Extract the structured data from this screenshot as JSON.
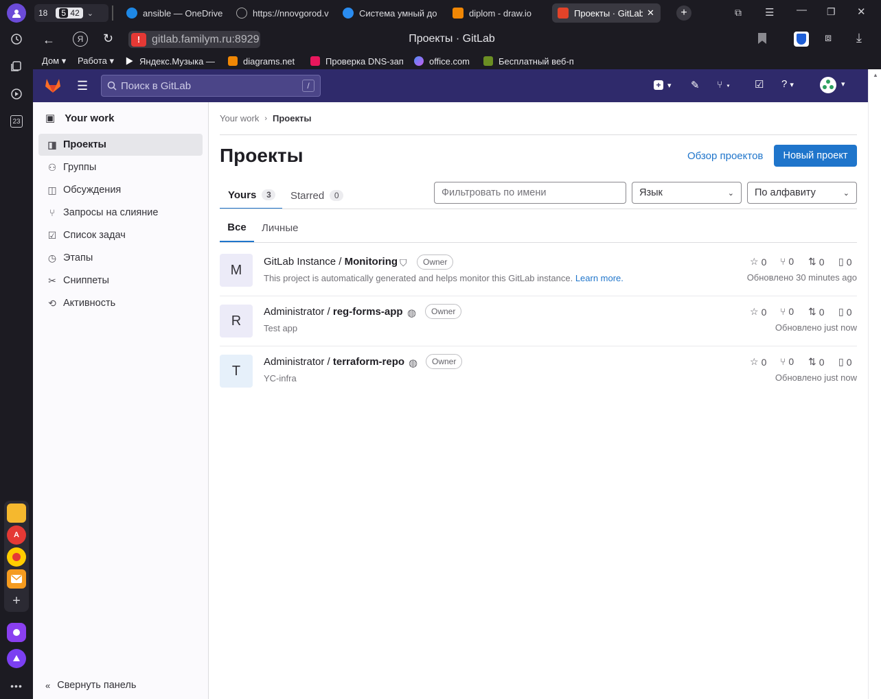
{
  "browser": {
    "tab_counter": "18",
    "tab_badge_a": "5",
    "tab_badge_b": "42",
    "tabs": [
      {
        "label": "ansible — OneDrive",
        "fav_color": "#1e88e5"
      },
      {
        "label": "https://nnovgorod.v",
        "fav_color": "#555"
      },
      {
        "label": "Система умный до",
        "fav_color": "#2a8cf0"
      },
      {
        "label": "diplom - draw.io",
        "fav_color": "#f08705"
      },
      {
        "label": "Проекты · GitLab",
        "fav_color": "#e24329"
      }
    ],
    "url": "gitlab.familym.ru:8929",
    "page_title": "Проекты · GitLab",
    "bookmarks": [
      {
        "label": "Дом ▾"
      },
      {
        "label": "Работа ▾"
      },
      {
        "label": "Яндекс.Музыка —"
      },
      {
        "label": "diagrams.net"
      },
      {
        "label": "Проверка DNS-зап"
      },
      {
        "label": "office.com"
      },
      {
        "label": "Бесплатный веб-п"
      }
    ],
    "rail_date": "23"
  },
  "gitlab": {
    "search_placeholder": "Поиск в GitLab",
    "search_shortcut": "/",
    "sidebar": {
      "context": "Your work",
      "items": [
        {
          "label": "Проекты"
        },
        {
          "label": "Группы"
        },
        {
          "label": "Обсуждения"
        },
        {
          "label": "Запросы на слияние"
        },
        {
          "label": "Список задач"
        },
        {
          "label": "Этапы"
        },
        {
          "label": "Сниппеты"
        },
        {
          "label": "Активность"
        }
      ],
      "collapse": "Свернуть панель"
    },
    "breadcrumb": {
      "root": "Your work",
      "current": "Проекты"
    },
    "title": "Проекты",
    "explore": "Обзор проектов",
    "new_project": "Новый проект",
    "tabs": [
      {
        "label": "Yours",
        "count": "3"
      },
      {
        "label": "Starred",
        "count": "0"
      }
    ],
    "filter_placeholder": "Фильтровать по имени",
    "language_select": "Язык",
    "sort_select": "По алфавиту",
    "subtabs": [
      "Все",
      "Личные"
    ],
    "projects": [
      {
        "letter": "M",
        "namespace": "GitLab Instance / ",
        "name": "Monitoring",
        "role": "Owner",
        "desc": "This project is automatically generated and helps monitor this GitLab instance.",
        "desc_link": "Learn more.",
        "stars": "0",
        "forks": "0",
        "mrs": "0",
        "issues": "0",
        "updated": "Обновлено 30 minutes ago",
        "avatar_bg": "#ecebf8"
      },
      {
        "letter": "R",
        "namespace": "Administrator / ",
        "name": "reg-forms-app",
        "role": "Owner",
        "desc": "Test app",
        "desc_link": "",
        "stars": "0",
        "forks": "0",
        "mrs": "0",
        "issues": "0",
        "updated": "Обновлено just now",
        "avatar_bg": "#ecebf8"
      },
      {
        "letter": "T",
        "namespace": "Administrator / ",
        "name": "terraform-repo",
        "role": "Owner",
        "desc": "YC-infra",
        "desc_link": "",
        "stars": "0",
        "forks": "0",
        "mrs": "0",
        "issues": "0",
        "updated": "Обновлено just now",
        "avatar_bg": "#e6f0fa"
      }
    ]
  }
}
